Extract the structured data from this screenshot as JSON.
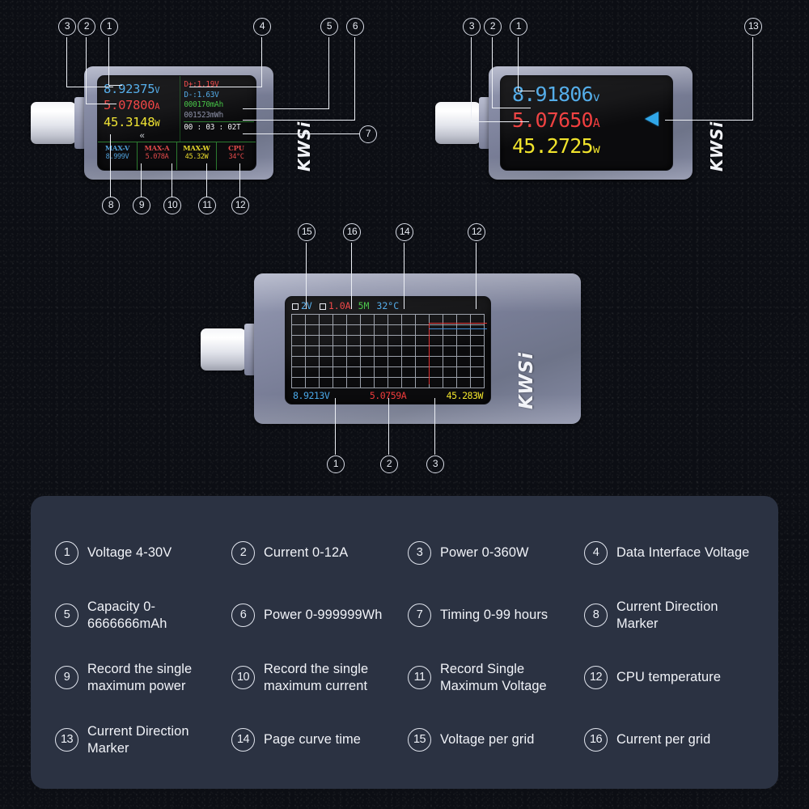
{
  "brand": "KWSi",
  "devices": [
    {
      "id": "device-detail-page",
      "screen": {
        "voltage": "8.92375",
        "voltage_unit": "V",
        "current": "5.07800",
        "current_unit": "A",
        "power": "45.3148",
        "power_unit": "W",
        "direction_marker": "«",
        "dplus": "D+:1.19V",
        "dminus": "D-:1.63V",
        "capacity": "000170mAh",
        "energy": "001523mWh",
        "timer": "00 : 03 : 02T",
        "max_cells": [
          {
            "label": "MAX-V",
            "value": "8.999V",
            "color": "#4f9fd8"
          },
          {
            "label": "MAX-A",
            "value": "5.078A",
            "color": "#e24a4a"
          },
          {
            "label": "MAX-W",
            "value": "45.32W",
            "color": "#e8d92c"
          },
          {
            "label": "CPU",
            "value": "34°C",
            "color": "#e24a4a"
          }
        ]
      }
    },
    {
      "id": "device-large-readout",
      "screen": {
        "voltage": "8.91806",
        "voltage_unit": "v",
        "current": "5.07650",
        "current_unit": "A",
        "power": "45.2725",
        "power_unit": "w",
        "direction_arrow": "left-arrow-marker"
      }
    },
    {
      "id": "device-curve-page",
      "screen": {
        "volt_per_grid": "2V",
        "amp_per_grid": "1.0A",
        "page_time": "5M",
        "cpu_temp": "32°C",
        "voltage": "8.9213V",
        "current": "5.0759A",
        "power": "45.283W"
      }
    }
  ],
  "callouts": {
    "device1_top": [
      "3",
      "2",
      "1",
      "4",
      "5",
      "6"
    ],
    "device1_right": [
      "7"
    ],
    "device1_bottom": [
      "8",
      "9",
      "10",
      "11",
      "12"
    ],
    "device2_top": [
      "3",
      "2",
      "1",
      "13"
    ],
    "device3_top": [
      "15",
      "16",
      "14",
      "12"
    ],
    "device3_bottom": [
      "1",
      "2",
      "3"
    ]
  },
  "legend": [
    {
      "num": "1",
      "text": "Voltage 4-30V"
    },
    {
      "num": "2",
      "text": "Current 0-12A"
    },
    {
      "num": "3",
      "text": "Power 0-360W"
    },
    {
      "num": "4",
      "text": "Data Interface Voltage"
    },
    {
      "num": "5",
      "text": "Capacity 0-6666666mAh"
    },
    {
      "num": "6",
      "text": "Power 0-999999Wh"
    },
    {
      "num": "7",
      "text": "Timing 0-99 hours"
    },
    {
      "num": "8",
      "text": "Current Direction Marker"
    },
    {
      "num": "9",
      "text": "Record the single maximum power"
    },
    {
      "num": "10",
      "text": "Record the single maximum current"
    },
    {
      "num": "11",
      "text": "Record Single Maximum Voltage"
    },
    {
      "num": "12",
      "text": "CPU temperature"
    },
    {
      "num": "13",
      "text": "Current Direction Marker"
    },
    {
      "num": "14",
      "text": "Page curve time"
    },
    {
      "num": "15",
      "text": "Voltage per grid"
    },
    {
      "num": "16",
      "text": "Current per grid"
    }
  ],
  "colors": {
    "background": "#0c0e14",
    "panel": "#2b3242",
    "voltage_blue": "#4aa8e8",
    "current_red": "#ef3b3b",
    "power_yellow": "#f0e32c",
    "grid_green": "#2c7a30",
    "marker_cyan": "#30a6e8"
  }
}
